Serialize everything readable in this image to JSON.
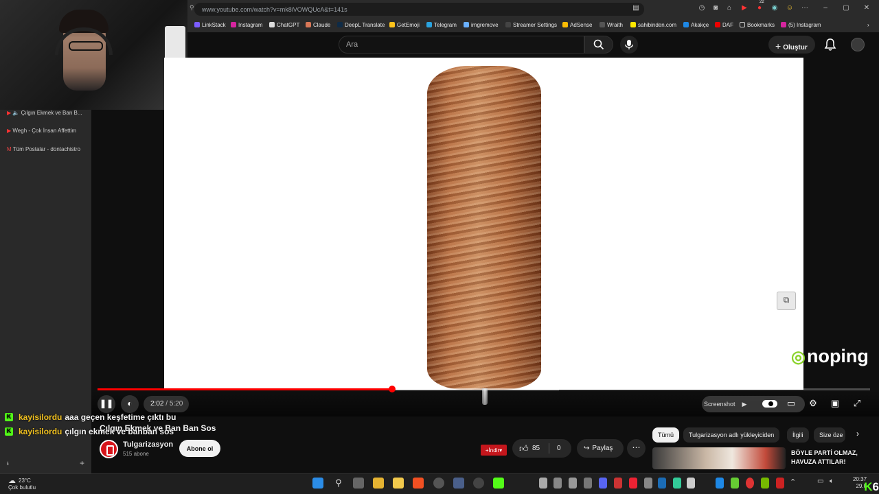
{
  "browser": {
    "url": "www.youtube.com/watch?v=mk8iVOWQUcA&t=141s",
    "bookmarks": [
      "LinkStack",
      "Instagram",
      "ChatGPT",
      "Claude",
      "DeepL Translate",
      "GetEmoji",
      "Telegram",
      "imgremove",
      "Streamer Settings",
      "AdSense",
      "Wraith",
      "sahibinden.com",
      "Akakçe",
      "DAF",
      "Bookmarks",
      "(5) Instagram"
    ],
    "ext_badge": "22"
  },
  "youtube": {
    "search_placeholder": "Ara",
    "create_label": "Oluştur"
  },
  "sidebar": {
    "items": [
      "Çılgın Ekmek ve Ban B...",
      "Wegh - Çok İnsan Affettim",
      "Tüm Postalar - dontachistro"
    ]
  },
  "player": {
    "current_time": "2:02",
    "duration": "5:20",
    "progress_fraction": 0.381,
    "screenshot_label": "Screenshot",
    "overlay_brand": "noping"
  },
  "video": {
    "title": "Çılgın Ekmek ve Ban Ban Sos",
    "channel": "Tulgarizasyon",
    "subscribers": "515 abone",
    "subscribe_label": "Abone ol",
    "download_label": "+İndir",
    "likes": "85",
    "dislikes": "0",
    "share_label": "Paylaş"
  },
  "chips": [
    "Tümü",
    "Tulgarizasyon adlı yükleyiciden",
    "İlgili",
    "Size öze"
  ],
  "recommendation": {
    "title": "BÖYLE PARTİ OLMAZ, HAVUZA ATTILAR!"
  },
  "chat": [
    {
      "user": "kayisilordu",
      "message": "aaa geçen keşfetime çıktı bu"
    },
    {
      "user": "kayisilordu",
      "message": "çılgın ekmek ve banban sos"
    }
  ],
  "taskbar": {
    "temperature": "23°C",
    "weather": "Çok bulutlu",
    "time": "20:37",
    "date": "29.0",
    "viewer_count": "6"
  },
  "colors": {
    "accent": "#ff0000",
    "kick_green": "#53fc18",
    "chat_username": "#f0c020"
  }
}
